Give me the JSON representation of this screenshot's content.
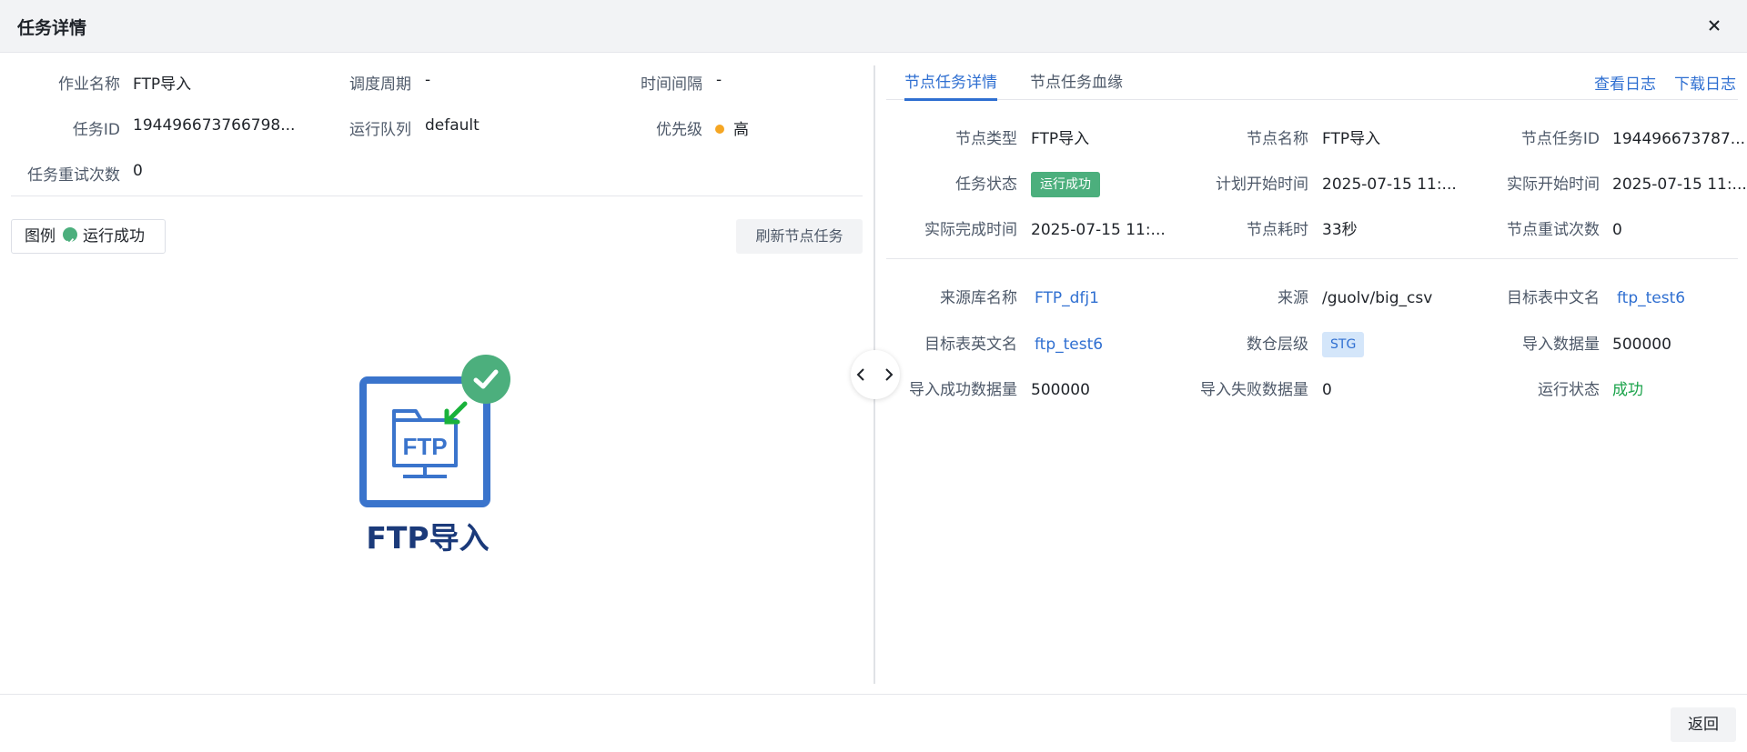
{
  "header": {
    "title": "任务详情"
  },
  "left": {
    "job_name_label": "作业名称",
    "job_name": "FTP导入",
    "schedule_label": "调度周期",
    "schedule": "-",
    "interval_label": "时间间隔",
    "interval": "-",
    "task_id_label": "任务ID",
    "task_id": "194496673766798...",
    "queue_label": "运行队列",
    "queue": "default",
    "priority_label": "优先级",
    "priority": "高",
    "retry_label": "任务重试次数",
    "retry": "0",
    "legend_label": "图例",
    "legend_status": "运行成功",
    "refresh_button": "刷新节点任务",
    "node_label": "FTP导入",
    "node_icon_text": "FTP"
  },
  "right": {
    "tabs": [
      {
        "label": "节点任务详情",
        "active": true
      },
      {
        "label": "节点任务血缘",
        "active": false
      }
    ],
    "view_log": "查看日志",
    "download_log": "下载日志",
    "node_type_label": "节点类型",
    "node_type": "FTP导入",
    "node_name_label": "节点名称",
    "node_name": "FTP导入",
    "node_task_id_label": "节点任务ID",
    "node_task_id": "194496673787...",
    "task_status_label": "任务状态",
    "task_status": "运行成功",
    "plan_start_label": "计划开始时间",
    "plan_start": "2025-07-15 11:...",
    "actual_start_label": "实际开始时间",
    "actual_start": "2025-07-15 11:...",
    "actual_end_label": "实际完成时间",
    "actual_end": "2025-07-15 11:...",
    "duration_label": "节点耗时",
    "duration": "33秒",
    "node_retry_label": "节点重试次数",
    "node_retry": "0",
    "source_db_label": "来源库名称",
    "source_db": "FTP_dfj1",
    "source_label": "来源",
    "source": "/guolv/big_csv",
    "target_cn_label": "目标表中文名",
    "target_cn": "ftp_test6",
    "target_en_label": "目标表英文名",
    "target_en": "ftp_test6",
    "layer_label": "数仓层级",
    "layer": "STG",
    "import_count_label": "导入数据量",
    "import_count": "500000",
    "import_ok_label": "导入成功数据量",
    "import_ok": "500000",
    "import_fail_label": "导入失败数据量",
    "import_fail": "0",
    "run_status_label": "运行状态",
    "run_status": "成功"
  },
  "footer": {
    "back_button": "返回"
  },
  "colors": {
    "primary": "#2f6fd1",
    "success": "#4caf7d",
    "priority": "#f5a623",
    "node_blue": "#3a74cc"
  },
  "icons": [
    "close-icon",
    "check-circle-icon",
    "ftp-folder-icon",
    "chevron-left-icon",
    "chevron-right-icon"
  ]
}
